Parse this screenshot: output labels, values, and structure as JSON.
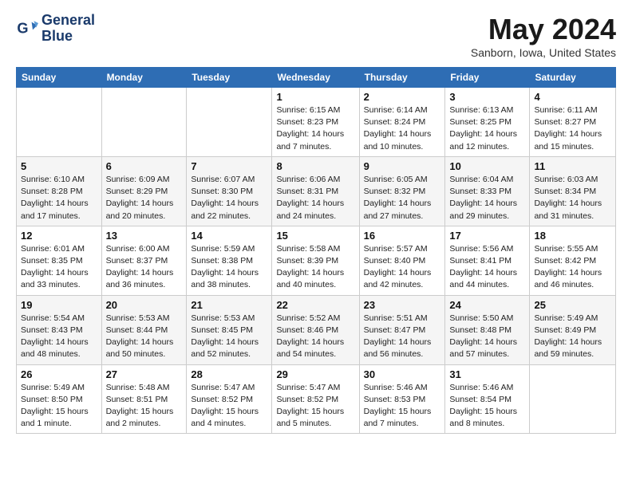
{
  "header": {
    "logo_line1": "General",
    "logo_line2": "Blue",
    "month_title": "May 2024",
    "location": "Sanborn, Iowa, United States"
  },
  "days_of_week": [
    "Sunday",
    "Monday",
    "Tuesday",
    "Wednesday",
    "Thursday",
    "Friday",
    "Saturday"
  ],
  "weeks": [
    [
      {
        "day": "",
        "info": ""
      },
      {
        "day": "",
        "info": ""
      },
      {
        "day": "",
        "info": ""
      },
      {
        "day": "1",
        "info": "Sunrise: 6:15 AM\nSunset: 8:23 PM\nDaylight: 14 hours\nand 7 minutes."
      },
      {
        "day": "2",
        "info": "Sunrise: 6:14 AM\nSunset: 8:24 PM\nDaylight: 14 hours\nand 10 minutes."
      },
      {
        "day": "3",
        "info": "Sunrise: 6:13 AM\nSunset: 8:25 PM\nDaylight: 14 hours\nand 12 minutes."
      },
      {
        "day": "4",
        "info": "Sunrise: 6:11 AM\nSunset: 8:27 PM\nDaylight: 14 hours\nand 15 minutes."
      }
    ],
    [
      {
        "day": "5",
        "info": "Sunrise: 6:10 AM\nSunset: 8:28 PM\nDaylight: 14 hours\nand 17 minutes."
      },
      {
        "day": "6",
        "info": "Sunrise: 6:09 AM\nSunset: 8:29 PM\nDaylight: 14 hours\nand 20 minutes."
      },
      {
        "day": "7",
        "info": "Sunrise: 6:07 AM\nSunset: 8:30 PM\nDaylight: 14 hours\nand 22 minutes."
      },
      {
        "day": "8",
        "info": "Sunrise: 6:06 AM\nSunset: 8:31 PM\nDaylight: 14 hours\nand 24 minutes."
      },
      {
        "day": "9",
        "info": "Sunrise: 6:05 AM\nSunset: 8:32 PM\nDaylight: 14 hours\nand 27 minutes."
      },
      {
        "day": "10",
        "info": "Sunrise: 6:04 AM\nSunset: 8:33 PM\nDaylight: 14 hours\nand 29 minutes."
      },
      {
        "day": "11",
        "info": "Sunrise: 6:03 AM\nSunset: 8:34 PM\nDaylight: 14 hours\nand 31 minutes."
      }
    ],
    [
      {
        "day": "12",
        "info": "Sunrise: 6:01 AM\nSunset: 8:35 PM\nDaylight: 14 hours\nand 33 minutes."
      },
      {
        "day": "13",
        "info": "Sunrise: 6:00 AM\nSunset: 8:37 PM\nDaylight: 14 hours\nand 36 minutes."
      },
      {
        "day": "14",
        "info": "Sunrise: 5:59 AM\nSunset: 8:38 PM\nDaylight: 14 hours\nand 38 minutes."
      },
      {
        "day": "15",
        "info": "Sunrise: 5:58 AM\nSunset: 8:39 PM\nDaylight: 14 hours\nand 40 minutes."
      },
      {
        "day": "16",
        "info": "Sunrise: 5:57 AM\nSunset: 8:40 PM\nDaylight: 14 hours\nand 42 minutes."
      },
      {
        "day": "17",
        "info": "Sunrise: 5:56 AM\nSunset: 8:41 PM\nDaylight: 14 hours\nand 44 minutes."
      },
      {
        "day": "18",
        "info": "Sunrise: 5:55 AM\nSunset: 8:42 PM\nDaylight: 14 hours\nand 46 minutes."
      }
    ],
    [
      {
        "day": "19",
        "info": "Sunrise: 5:54 AM\nSunset: 8:43 PM\nDaylight: 14 hours\nand 48 minutes."
      },
      {
        "day": "20",
        "info": "Sunrise: 5:53 AM\nSunset: 8:44 PM\nDaylight: 14 hours\nand 50 minutes."
      },
      {
        "day": "21",
        "info": "Sunrise: 5:53 AM\nSunset: 8:45 PM\nDaylight: 14 hours\nand 52 minutes."
      },
      {
        "day": "22",
        "info": "Sunrise: 5:52 AM\nSunset: 8:46 PM\nDaylight: 14 hours\nand 54 minutes."
      },
      {
        "day": "23",
        "info": "Sunrise: 5:51 AM\nSunset: 8:47 PM\nDaylight: 14 hours\nand 56 minutes."
      },
      {
        "day": "24",
        "info": "Sunrise: 5:50 AM\nSunset: 8:48 PM\nDaylight: 14 hours\nand 57 minutes."
      },
      {
        "day": "25",
        "info": "Sunrise: 5:49 AM\nSunset: 8:49 PM\nDaylight: 14 hours\nand 59 minutes."
      }
    ],
    [
      {
        "day": "26",
        "info": "Sunrise: 5:49 AM\nSunset: 8:50 PM\nDaylight: 15 hours\nand 1 minute."
      },
      {
        "day": "27",
        "info": "Sunrise: 5:48 AM\nSunset: 8:51 PM\nDaylight: 15 hours\nand 2 minutes."
      },
      {
        "day": "28",
        "info": "Sunrise: 5:47 AM\nSunset: 8:52 PM\nDaylight: 15 hours\nand 4 minutes."
      },
      {
        "day": "29",
        "info": "Sunrise: 5:47 AM\nSunset: 8:52 PM\nDaylight: 15 hours\nand 5 minutes."
      },
      {
        "day": "30",
        "info": "Sunrise: 5:46 AM\nSunset: 8:53 PM\nDaylight: 15 hours\nand 7 minutes."
      },
      {
        "day": "31",
        "info": "Sunrise: 5:46 AM\nSunset: 8:54 PM\nDaylight: 15 hours\nand 8 minutes."
      },
      {
        "day": "",
        "info": ""
      }
    ]
  ]
}
